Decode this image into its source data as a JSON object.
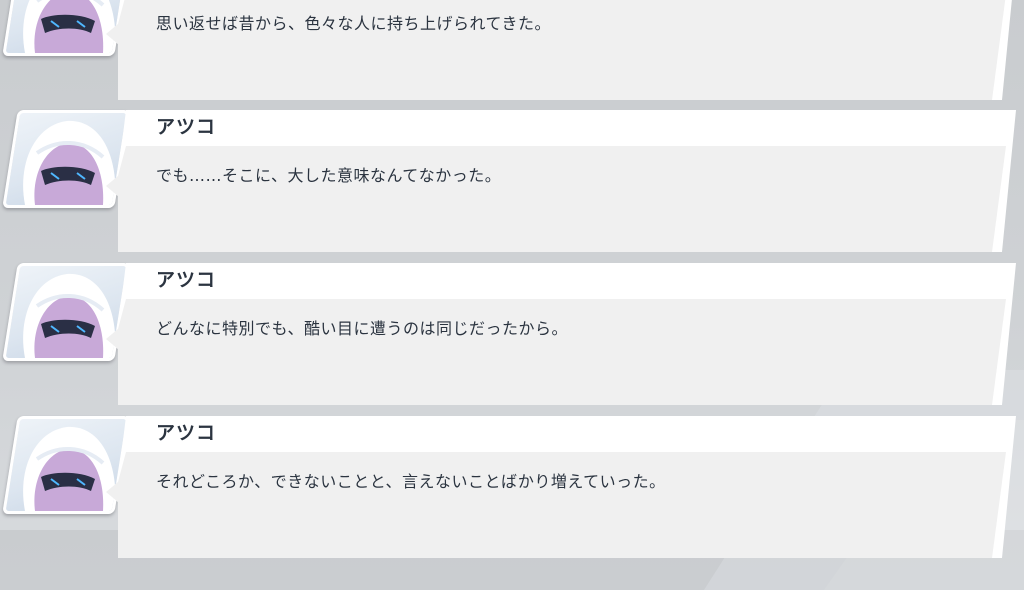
{
  "backlog": {
    "entries": [
      {
        "speaker": "",
        "text": "思い返せば昔から、色々な人に持ち上げられてきた。"
      },
      {
        "speaker": "アツコ",
        "text": "でも……そこに、大した意味なんてなかった。"
      },
      {
        "speaker": "アツコ",
        "text": "どんなに特別でも、酷い目に遭うのは同じだったから。"
      },
      {
        "speaker": "アツコ",
        "text": "それどころか、できないことと、言えないことばかり増えていった。"
      }
    ]
  },
  "colors": {
    "background": "#cdd0d3",
    "card_header": "#ffffff",
    "card_body": "#f0f0f0",
    "text": "#2b3440",
    "avatar_hair": "#c8a9d8",
    "avatar_hood": "#ffffff",
    "avatar_mask": "#2a2f45"
  },
  "icons": {
    "avatar": "atsuko-portrait-icon"
  }
}
